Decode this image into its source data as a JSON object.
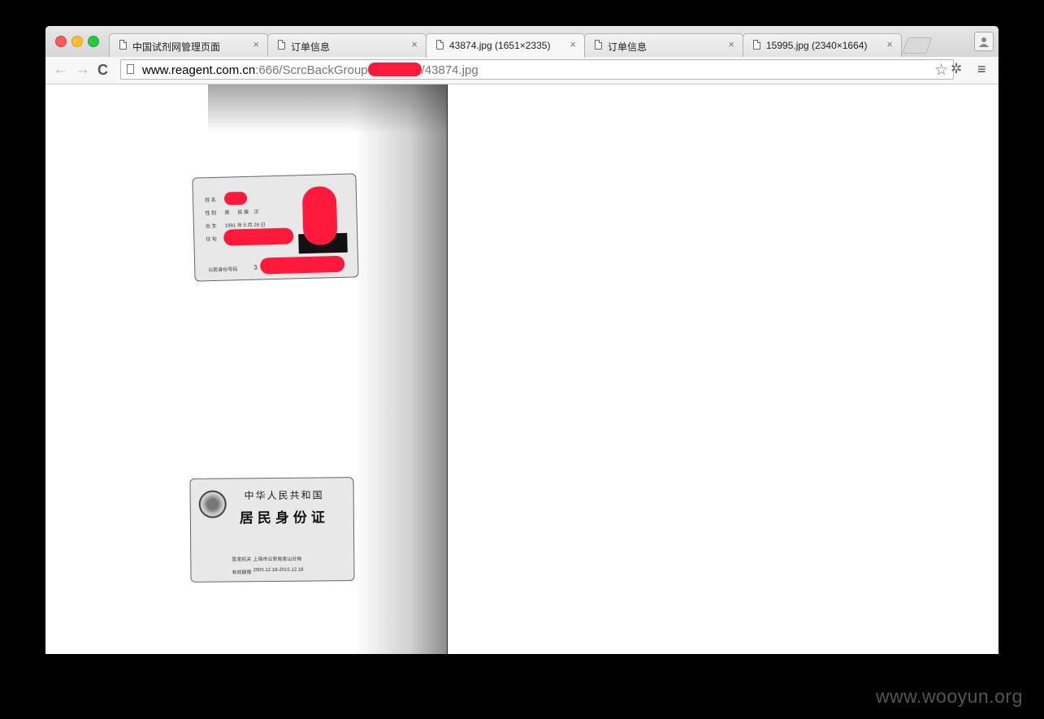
{
  "tabs": [
    {
      "title": "中国试剂网管理页面"
    },
    {
      "title": "订单信息"
    },
    {
      "title": "43874.jpg (1651×2335)",
      "active": true
    },
    {
      "title": "订单信息"
    },
    {
      "title": "15995.jpg (2340×1664)"
    }
  ],
  "tab_close_glyph": "×",
  "toolbar": {
    "back_glyph": "←",
    "forward_glyph": "→",
    "reload_glyph": "C",
    "url_host": "www.reagent.com.cn",
    "url_path_visible": ":666/ScrcBackGroup",
    "url_tail": "/43874.jpg",
    "star_glyph": "☆",
    "extension_glyph": "✲",
    "menu_glyph": "≡"
  },
  "id_front": {
    "name_label": "姓 名",
    "sex_label": "性 别",
    "sex_value": "男",
    "ethnic_label": "民 族",
    "ethnic_value": "汉",
    "birth_label": "出 生",
    "birth_value": "1991 年 5 月 28 日",
    "address_label": "住 址",
    "id_label": "公民身份号码",
    "id_first_digit": "3"
  },
  "id_back": {
    "country": "中华人民共和国",
    "title": "居民身份证",
    "authority_label": "签发机关",
    "authority_value": "上海市公安局金山分局",
    "validity_label": "有效期限",
    "validity_value": "2005.12.18-2015.12.18"
  },
  "watermark": "www.wooyun.org",
  "colors": {
    "redaction": "#ff1a3c"
  },
  "icons": {
    "page": "page-icon",
    "profile": "person-icon"
  }
}
